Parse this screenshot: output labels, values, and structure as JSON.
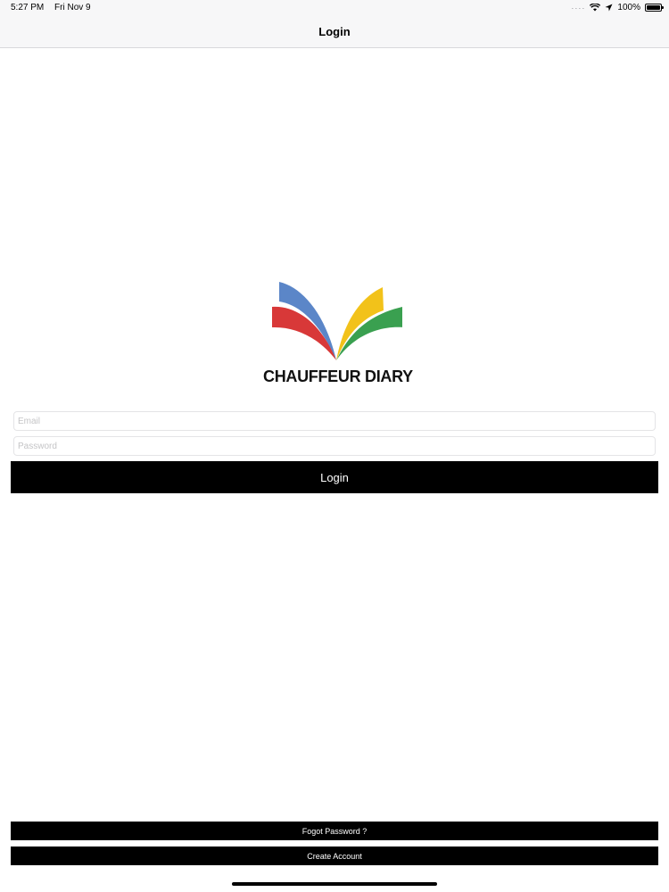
{
  "status_bar": {
    "time": "5:27 PM",
    "date": "Fri Nov 9",
    "battery": "100%",
    "battery_level": 1.0,
    "icons": [
      "cellular-signal-icon",
      "wifi-icon",
      "location-arrow-icon",
      "battery-icon"
    ]
  },
  "nav": {
    "title": "Login"
  },
  "logo": {
    "text": "CHAUFFEUR DIARY",
    "colors": {
      "blue": "#5b86c8",
      "red": "#d83838",
      "yellow": "#f2c21a",
      "green": "#3aa050"
    }
  },
  "form": {
    "email_placeholder": "Email",
    "email_value": "",
    "password_placeholder": "Password",
    "password_value": "",
    "login_label": "Login"
  },
  "footer": {
    "forgot_label": "Fogot Password ?",
    "create_label": "Create Account"
  },
  "colors": {
    "button_bg": "#000000",
    "button_text": "#ffffff",
    "bar_bg": "#f7f7f8"
  }
}
